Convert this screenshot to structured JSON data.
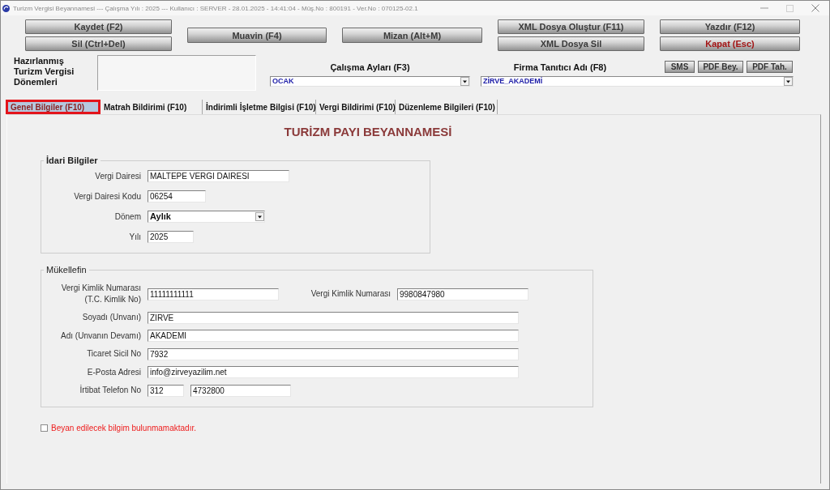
{
  "window": {
    "title": "Turizm Vergisi Beyannamesi --- Çalışma Yılı : 2025 --- Kullanıcı : SERVER - 28.01.2025 - 14:41:04 - Müş.No : 800191 - Ver.No : 070125-02.1"
  },
  "toolbar": {
    "columns": [
      {
        "buttons": [
          {
            "label": "Kaydet (F2)",
            "kind": "standard"
          },
          {
            "label": "Sil (Ctrl+Del)",
            "kind": "standard"
          }
        ]
      },
      {
        "buttons": [
          {
            "label": "Muavin (F4)",
            "kind": "standard"
          }
        ]
      },
      {
        "buttons": [
          {
            "label": "Mizan (Alt+M)",
            "kind": "standard"
          }
        ]
      },
      {
        "buttons": [
          {
            "label": "XML Dosya Oluştur (F11)",
            "kind": "standard"
          },
          {
            "label": "XML Dosya Sil",
            "kind": "standard"
          }
        ]
      },
      {
        "buttons": [
          {
            "label": "Yazdır (F12)",
            "kind": "standard"
          },
          {
            "label": "Kapat (Esc)",
            "kind": "exit"
          }
        ]
      }
    ]
  },
  "prepared_periods": {
    "label": "Hazırlanmış Turizm Vergisi Dönemleri"
  },
  "working_months": {
    "label": "Çalışma Ayları (F3)",
    "value": "OCAK"
  },
  "company": {
    "label": "Firma Tanıtıcı Adı (F8)",
    "value": "ZİRVE_AKADEMİ",
    "buttons": [
      "SMS",
      "PDF Bey.",
      "PDF Tah."
    ]
  },
  "tabs": [
    {
      "label": "Genel Bilgiler (F10)",
      "selected": true,
      "highlighted": true
    },
    {
      "label": "Matrah Bildirimi (F10)",
      "selected": false,
      "highlighted": false
    },
    {
      "label": "İndirimli İşletme Bilgisi (F10)",
      "selected": false,
      "highlighted": false
    },
    {
      "label": "Vergi Bildirimi (F10)",
      "selected": false,
      "highlighted": false
    },
    {
      "label": "Düzenleme Bilgileri (F10)",
      "selected": false,
      "highlighted": false
    }
  ],
  "form": {
    "title": "TURİZM PAYI BEYANNAMESİ",
    "groups": [
      {
        "legend": "İdari Bilgiler",
        "legend_bold": true,
        "rows": [
          {
            "kind": "text",
            "label": "Vergi Dairesi",
            "values": [
              "MALTEPE VERGİ DAİRESİ"
            ]
          },
          {
            "kind": "text",
            "label": "Vergi Dairesi Kodu",
            "values": [
              "06254"
            ]
          },
          {
            "kind": "select",
            "label": "Dönem",
            "values": [
              "Aylık"
            ]
          },
          {
            "kind": "text",
            "label": "Yılı",
            "values": [
              "2025"
            ]
          }
        ]
      },
      {
        "legend": "Mükellefin",
        "legend_bold": false,
        "rows": [
          {
            "kind": "text",
            "label": "Vergi Kimlik Numarası (T.C. Kimlik No)",
            "values": [
              "11111111111"
            ],
            "side": {
              "label": "Vergi Kimlik Numarası",
              "value": "9980847980"
            }
          },
          {
            "kind": "text",
            "label": "Soyadı (Unvanı)",
            "values": [
              "ZİRVE"
            ]
          },
          {
            "kind": "text",
            "label": "Adı (Unvanın Devamı)",
            "values": [
              "AKADEMİ"
            ]
          },
          {
            "kind": "text",
            "label": "Ticaret Sicil No",
            "values": [
              "7932"
            ]
          },
          {
            "kind": "text",
            "label": "E-Posta Adresi",
            "values": [
              "info@zirveyazilim.net"
            ]
          },
          {
            "kind": "text",
            "label": "İrtibat Telefon No",
            "values": [
              "312",
              "4732800"
            ]
          }
        ]
      }
    ]
  },
  "declaration": {
    "label": "Beyan edilecek bilgim bulunmamaktadır.",
    "checked": false
  }
}
